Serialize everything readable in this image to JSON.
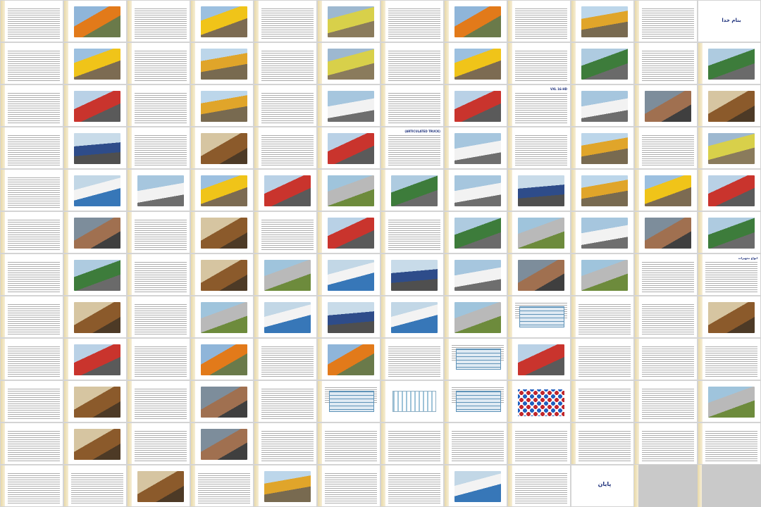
{
  "document": {
    "layout": "slide-sorter",
    "rows": 12,
    "columns": 12,
    "slides": [
      {
        "t": "v",
        "title": ""
      },
      {
        "t": "i",
        "title": "",
        "c": "c1"
      },
      {
        "t": "v",
        "title": ""
      },
      {
        "t": "i",
        "title": "",
        "c": "c2"
      },
      {
        "t": "v",
        "title": ""
      },
      {
        "t": "i",
        "title": "",
        "c": "c5"
      },
      {
        "t": "v",
        "title": ""
      },
      {
        "t": "i",
        "title": "",
        "c": "c1"
      },
      {
        "t": "v",
        "title": ""
      },
      {
        "t": "i",
        "title": "",
        "c": "c9"
      },
      {
        "t": "v",
        "title": ""
      },
      {
        "t": "first",
        "title": "بنام خدا"
      },
      {
        "t": "v",
        "title": ""
      },
      {
        "t": "i",
        "title": "",
        "c": "c2"
      },
      {
        "t": "v",
        "title": ""
      },
      {
        "t": "i",
        "title": "",
        "c": "c9"
      },
      {
        "t": "v",
        "title": ""
      },
      {
        "t": "i",
        "title": "",
        "c": "c5"
      },
      {
        "t": "v",
        "title": ""
      },
      {
        "t": "i",
        "title": "",
        "c": "c2"
      },
      {
        "t": "v",
        "title": ""
      },
      {
        "t": "i",
        "title": "",
        "c": "c10"
      },
      {
        "t": "v",
        "title": ""
      },
      {
        "t": "i",
        "title": "",
        "c": "c10"
      },
      {
        "t": "v",
        "title": ""
      },
      {
        "t": "i",
        "title": "",
        "c": "c4"
      },
      {
        "t": "v",
        "title": ""
      },
      {
        "t": "i",
        "title": "",
        "c": "c9"
      },
      {
        "t": "v",
        "title": ""
      },
      {
        "t": "i",
        "title": "",
        "c": "c3"
      },
      {
        "t": "v",
        "title": ""
      },
      {
        "t": "i",
        "title": "",
        "c": "c4"
      },
      {
        "t": "v",
        "title": "VXL 16-HD"
      },
      {
        "t": "i",
        "title": "",
        "c": "c3"
      },
      {
        "t": "i",
        "title": "",
        "c": "c8"
      },
      {
        "t": "i",
        "title": "",
        "c": "c11"
      },
      {
        "t": "v",
        "title": ""
      },
      {
        "t": "i",
        "title": "",
        "c": "c6"
      },
      {
        "t": "v",
        "title": ""
      },
      {
        "t": "i",
        "title": "",
        "c": "c11"
      },
      {
        "t": "v",
        "title": ""
      },
      {
        "t": "i",
        "title": "",
        "c": "c4"
      },
      {
        "t": "v",
        "title": "(ARTICULATED TRUCK)"
      },
      {
        "t": "i",
        "title": "",
        "c": "c3"
      },
      {
        "t": "v",
        "title": ""
      },
      {
        "t": "i",
        "title": "",
        "c": "c9"
      },
      {
        "t": "v",
        "title": ""
      },
      {
        "t": "i",
        "title": "",
        "c": "c5"
      },
      {
        "t": "v",
        "title": ""
      },
      {
        "t": "i",
        "title": "",
        "c": "c12"
      },
      {
        "t": "i",
        "title": "",
        "c": "c3"
      },
      {
        "t": "i",
        "title": "",
        "c": "c2"
      },
      {
        "t": "i",
        "title": "",
        "c": "c4"
      },
      {
        "t": "i",
        "title": "",
        "c": "c7"
      },
      {
        "t": "i",
        "title": "",
        "c": "c10"
      },
      {
        "t": "i",
        "title": "",
        "c": "c3"
      },
      {
        "t": "i",
        "title": "",
        "c": "c6"
      },
      {
        "t": "i",
        "title": "",
        "c": "c9"
      },
      {
        "t": "i",
        "title": "",
        "c": "c2"
      },
      {
        "t": "i",
        "title": "",
        "c": "c4"
      },
      {
        "t": "v",
        "title": ""
      },
      {
        "t": "i",
        "title": "",
        "c": "c8"
      },
      {
        "t": "v",
        "title": ""
      },
      {
        "t": "i",
        "title": "",
        "c": "c11"
      },
      {
        "t": "v",
        "title": ""
      },
      {
        "t": "i",
        "title": "",
        "c": "c4"
      },
      {
        "t": "v",
        "title": ""
      },
      {
        "t": "i",
        "title": "",
        "c": "c10"
      },
      {
        "t": "i",
        "title": "",
        "c": "c7"
      },
      {
        "t": "i",
        "title": "",
        "c": "c3"
      },
      {
        "t": "i",
        "title": "",
        "c": "c8"
      },
      {
        "t": "i",
        "title": "",
        "c": "c10"
      },
      {
        "t": "v",
        "title": ""
      },
      {
        "t": "i",
        "title": "",
        "c": "c10"
      },
      {
        "t": "v",
        "title": ""
      },
      {
        "t": "i",
        "title": "",
        "c": "c11"
      },
      {
        "t": "i",
        "title": "",
        "c": "c7"
      },
      {
        "t": "i",
        "title": "",
        "c": "c12"
      },
      {
        "t": "i",
        "title": "",
        "c": "c6"
      },
      {
        "t": "i",
        "title": "",
        "c": "c3"
      },
      {
        "t": "i",
        "title": "",
        "c": "c8"
      },
      {
        "t": "i",
        "title": "",
        "c": "c7"
      },
      {
        "t": "v",
        "title": ""
      },
      {
        "t": "v",
        "title": "انواع تجهیزات"
      },
      {
        "t": "v",
        "title": ""
      },
      {
        "t": "i",
        "title": "",
        "c": "c11"
      },
      {
        "t": "v",
        "title": ""
      },
      {
        "t": "i",
        "title": "",
        "c": "c7"
      },
      {
        "t": "i",
        "title": "",
        "c": "c12"
      },
      {
        "t": "i",
        "title": "",
        "c": "c6"
      },
      {
        "t": "i",
        "title": "",
        "c": "c12"
      },
      {
        "t": "i",
        "title": "",
        "c": "c7"
      },
      {
        "t": "tb",
        "title": ""
      },
      {
        "t": "v",
        "title": ""
      },
      {
        "t": "v",
        "title": ""
      },
      {
        "t": "i",
        "title": "",
        "c": "c11"
      },
      {
        "t": "v",
        "title": ""
      },
      {
        "t": "i",
        "title": "",
        "c": "c4"
      },
      {
        "t": "v",
        "title": ""
      },
      {
        "t": "i",
        "title": "",
        "c": "c1"
      },
      {
        "t": "v",
        "title": ""
      },
      {
        "t": "i",
        "title": "",
        "c": "c1"
      },
      {
        "t": "v",
        "title": ""
      },
      {
        "t": "tb",
        "title": ""
      },
      {
        "t": "i",
        "title": "",
        "c": "c4"
      },
      {
        "t": "v",
        "title": ""
      },
      {
        "t": "v",
        "title": ""
      },
      {
        "t": "v",
        "title": ""
      },
      {
        "t": "v",
        "title": ""
      },
      {
        "t": "i",
        "title": "",
        "c": "c11"
      },
      {
        "t": "v",
        "title": ""
      },
      {
        "t": "i",
        "title": "",
        "c": "c8"
      },
      {
        "t": "v",
        "title": ""
      },
      {
        "t": "tb",
        "title": ""
      },
      {
        "t": "dg",
        "title": ""
      },
      {
        "t": "tb",
        "title": ""
      },
      {
        "t": "sg",
        "title": ""
      },
      {
        "t": "v",
        "title": ""
      },
      {
        "t": "v",
        "title": ""
      },
      {
        "t": "i",
        "title": "",
        "c": "c7"
      },
      {
        "t": "v",
        "title": ""
      },
      {
        "t": "i",
        "title": "",
        "c": "c11"
      },
      {
        "t": "v",
        "title": ""
      },
      {
        "t": "i",
        "title": "",
        "c": "c8"
      },
      {
        "t": "v",
        "title": ""
      },
      {
        "t": "v",
        "title": ""
      },
      {
        "t": "v",
        "title": ""
      },
      {
        "t": "v",
        "title": ""
      },
      {
        "t": "v",
        "title": ""
      },
      {
        "t": "v",
        "title": ""
      },
      {
        "t": "v",
        "title": ""
      },
      {
        "t": "v",
        "title": ""
      },
      {
        "t": "v",
        "title": ""
      },
      {
        "t": "v",
        "title": ""
      },
      {
        "t": "i",
        "title": "",
        "c": "c11"
      },
      {
        "t": "v",
        "title": ""
      },
      {
        "t": "i",
        "title": "",
        "c": "c9"
      },
      {
        "t": "v",
        "title": ""
      },
      {
        "t": "v",
        "title": ""
      },
      {
        "t": "i",
        "title": "",
        "c": "c12"
      },
      {
        "t": "v",
        "title": ""
      },
      {
        "t": "last",
        "title": "پایان"
      },
      {
        "t": "blank",
        "title": ""
      },
      {
        "t": "blank",
        "title": ""
      }
    ]
  }
}
